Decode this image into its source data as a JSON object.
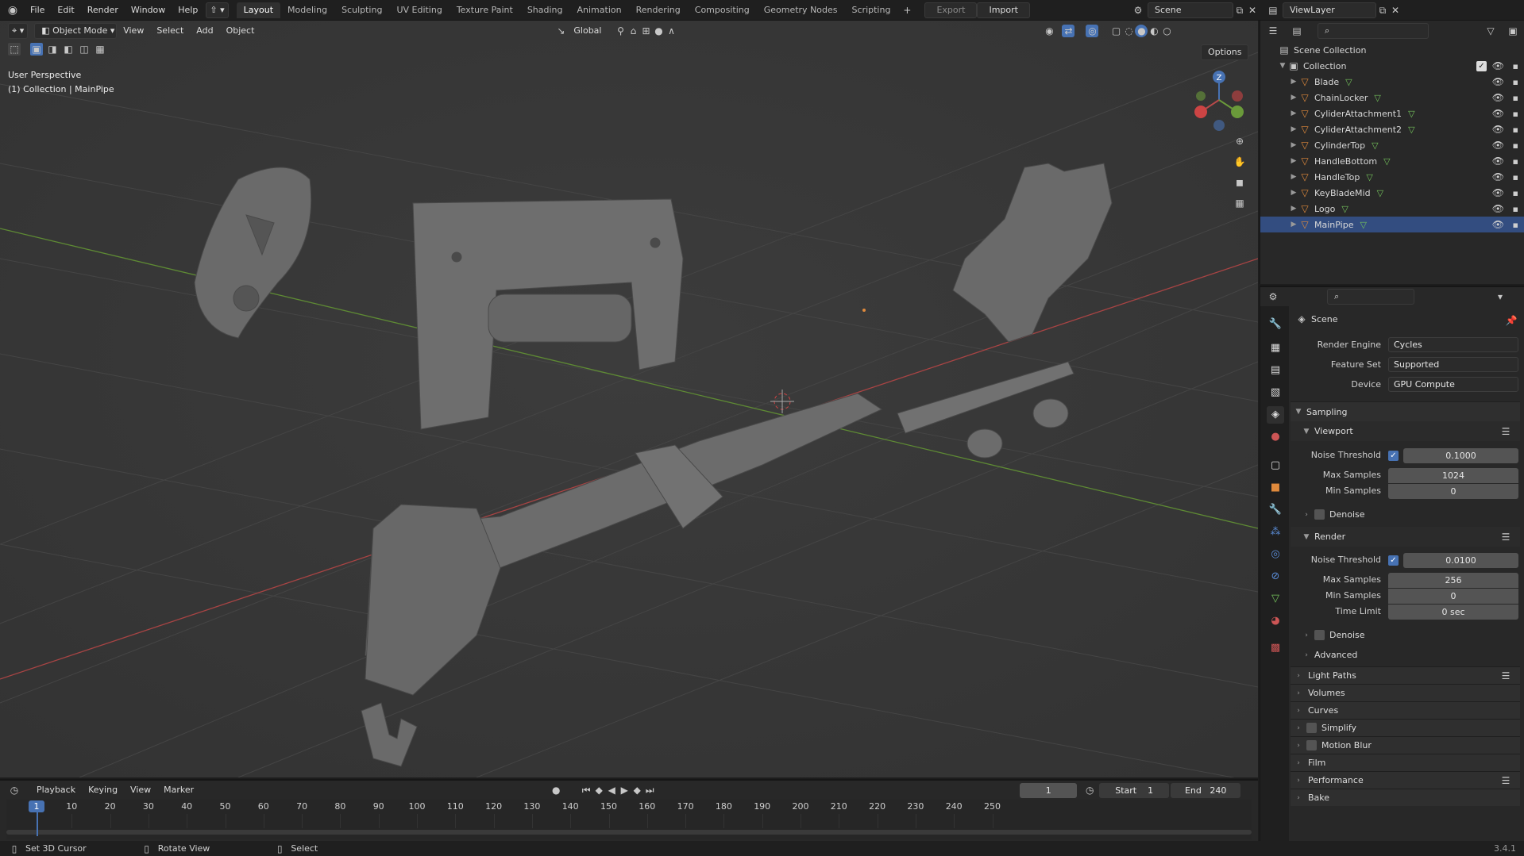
{
  "topbar": {
    "menus": [
      "File",
      "Edit",
      "Render",
      "Window",
      "Help"
    ],
    "workspaces": [
      "Layout",
      "Modeling",
      "Sculpting",
      "UV Editing",
      "Texture Paint",
      "Shading",
      "Animation",
      "Rendering",
      "Compositing",
      "Geometry Nodes",
      "Scripting"
    ],
    "active_workspace": "Layout",
    "export_label": "Export",
    "import_label": "Import",
    "scene_name": "Scene",
    "view_layer": "ViewLayer"
  },
  "viewport": {
    "mode": "Object Mode",
    "menus": [
      "View",
      "Select",
      "Add",
      "Object"
    ],
    "orientation": "Global",
    "options_label": "Options",
    "overlay_line1": "User Perspective",
    "overlay_line2": "(1) Collection | MainPipe",
    "gizmo_axis_label": "Z"
  },
  "outliner": {
    "root": "Scene Collection",
    "collection": "Collection",
    "objects": [
      "Blade",
      "ChainLocker",
      "CyliderAttachment1",
      "CyliderAttachment2",
      "CylinderTop",
      "HandleBottom",
      "HandleTop",
      "KeyBladeMid",
      "Logo",
      "MainPipe"
    ],
    "active_object": "MainPipe"
  },
  "properties": {
    "context": "Scene",
    "render_engine_label": "Render Engine",
    "render_engine": "Cycles",
    "feature_set_label": "Feature Set",
    "feature_set": "Supported",
    "device_label": "Device",
    "device": "GPU Compute",
    "sampling": "Sampling",
    "viewport": "Viewport",
    "noise_threshold_label": "Noise Threshold",
    "viewport_noise_threshold": "0.1000",
    "max_samples_label": "Max Samples",
    "viewport_max_samples": "1024",
    "min_samples_label": "Min Samples",
    "viewport_min_samples": "0",
    "denoise": "Denoise",
    "render": "Render",
    "render_noise_threshold": "0.0100",
    "render_max_samples": "256",
    "render_min_samples": "0",
    "time_limit_label": "Time Limit",
    "time_limit": "0 sec",
    "advanced": "Advanced",
    "panels": [
      "Light Paths",
      "Volumes",
      "Curves",
      "Simplify",
      "Motion Blur",
      "Film",
      "Performance",
      "Bake"
    ]
  },
  "timeline": {
    "menus": [
      "Playback",
      "Keying",
      "View",
      "Marker"
    ],
    "current_frame": "1",
    "start_label": "Start",
    "start": "1",
    "end_label": "End",
    "end": "240",
    "ticks": [
      "1",
      "10",
      "20",
      "30",
      "40",
      "50",
      "60",
      "70",
      "80",
      "90",
      "100",
      "110",
      "120",
      "130",
      "140",
      "150",
      "160",
      "170",
      "180",
      "190",
      "200",
      "210",
      "220",
      "230",
      "240",
      "250"
    ]
  },
  "statusbar": {
    "hint1": "Set 3D Cursor",
    "hint2": "Rotate View",
    "hint3": "Select",
    "version": "3.4.1"
  },
  "colors": {
    "accent": "#4772b3",
    "active_row": "#334d80",
    "mesh_icon": "#e08a3c",
    "data_icon": "#74c25b",
    "x_axis": "#b84a4a",
    "y_axis": "#6a9a3a"
  }
}
